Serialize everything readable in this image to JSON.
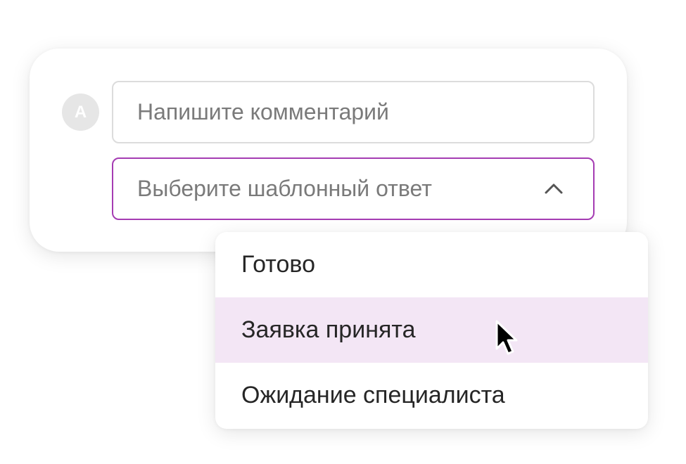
{
  "user": {
    "avatar_initial": "A"
  },
  "comment": {
    "placeholder": "Напишите комментарий",
    "value": ""
  },
  "template_select": {
    "placeholder": "Выберите шаблонный ответ",
    "expanded": true,
    "accent_color": "#a53cb3",
    "icon": "chevron-up-icon"
  },
  "dropdown": {
    "options": [
      {
        "label": "Готово"
      },
      {
        "label": "Заявка принята",
        "hovered": true
      },
      {
        "label": "Ожидание специалиста"
      }
    ],
    "hover_color": "#f3e6f5"
  },
  "cursor": {
    "icon": "mouse-pointer-icon"
  }
}
